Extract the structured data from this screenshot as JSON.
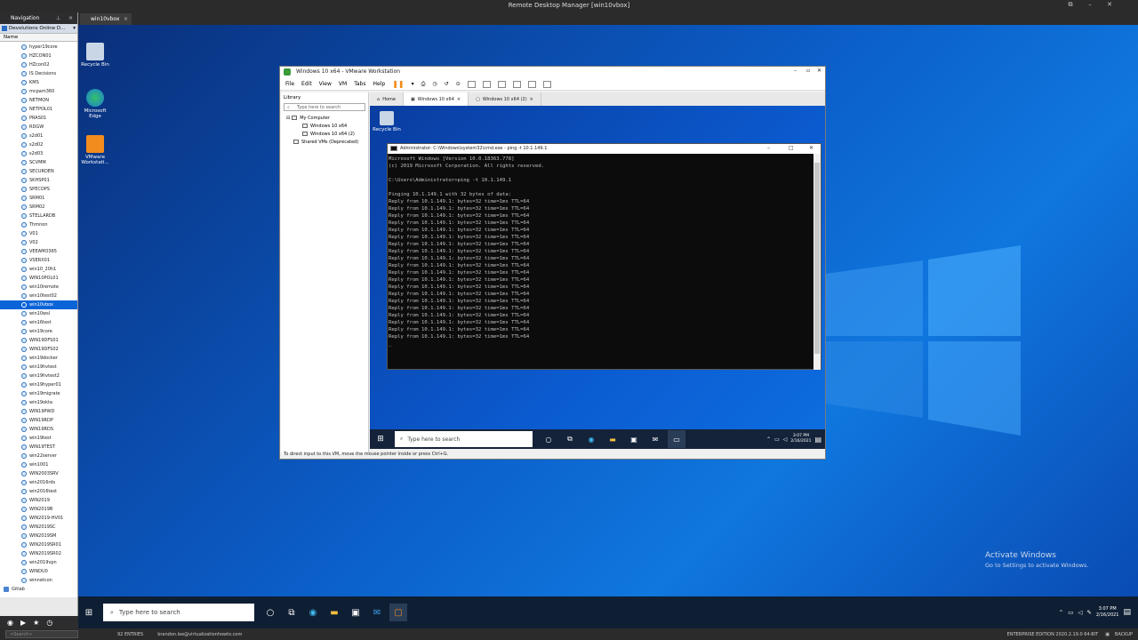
{
  "app": {
    "title": "Remote Desktop Manager [win10vbox]",
    "window_controls": [
      "⧉",
      "–",
      "✕"
    ]
  },
  "navigation": {
    "title": "Navigation",
    "datasource": "Devolutions Online D...",
    "column_header": "Name",
    "items": [
      "hyper19core",
      "HZCON01",
      "HZcon02",
      "IS Decisions",
      "KMS",
      "mcpam360",
      "NETMON",
      "NETPOL01",
      "PRAS01",
      "RDGW",
      "s2d01",
      "s2d02",
      "s2d03",
      "SCVMM",
      "SECURDEN",
      "SKHSP01",
      "SPECOPS",
      "SRM01",
      "SRM02",
      "STELLARDB",
      "Thmnon",
      "V01",
      "V02",
      "VEEAMO365",
      "VSERX01",
      "win10_20h1",
      "WIN10POL01",
      "win10remote",
      "win10test02",
      "win10vbox",
      "win10wsl",
      "win16test",
      "win19core",
      "WIN19DFS01",
      "WIN19DFS02",
      "win19docker",
      "win19hvtest",
      "win19hvtest2",
      "win19hyper01",
      "win19migrate",
      "win19okta",
      "WIN19PWD",
      "WIN19RDP",
      "WIN19RDS",
      "win19test",
      "WIN19TEST",
      "win22server",
      "win1001",
      "WIN2003SRV",
      "win2016rds",
      "win2016test",
      "WIN2019",
      "WIN2019B",
      "WIN2019-HV01",
      "WIN2019SC",
      "WIN2019SM",
      "WIN2019SR01",
      "WIN2019SR02",
      "win2019vpn",
      "WINDU0",
      "winnetcon"
    ],
    "selected": "win10vbox",
    "root_item": "Gitlab"
  },
  "tab": {
    "label": "win10vbox",
    "close": "×"
  },
  "desktop": {
    "icons": [
      "Recycle Bin",
      "Microsoft Edge",
      "VMware Workstati..."
    ],
    "activate_title": "Activate Windows",
    "activate_sub": "Go to Settings to activate Windows."
  },
  "taskbar": {
    "search_placeholder": "Type here to search",
    "time": "3:07 PM",
    "date": "2/16/2021"
  },
  "status": {
    "search_placeholder": "<Search>",
    "entries": "92 ENTRIES",
    "email": "brandon.lee@virtualizationhowto.com",
    "edition": "ENTERPRISE EDITION 2020.2.19.0 64-BIT",
    "backup": "BACKUP"
  },
  "vmware": {
    "title": "Windows 10 x64 - VMware Workstation",
    "menu": [
      "File",
      "Edit",
      "View",
      "VM",
      "Tabs",
      "Help"
    ],
    "library": {
      "title": "Library",
      "search_placeholder": "Type here to search",
      "tree": [
        "My Computer",
        "Windows 10 x64",
        "Windows 10 x64 (2)",
        "Shared VMs (Deprecated)"
      ]
    },
    "tabs": [
      "Home",
      "Windows 10 x64",
      "Windows 10 x64 (2)"
    ],
    "status": "To direct input to this VM, move the mouse pointer inside or press Ctrl+G."
  },
  "guest": {
    "recycle_bin": "Recycle Bin",
    "search_placeholder": "Type here to search",
    "time": "3:07 PM",
    "date": "2/16/2021"
  },
  "cmd": {
    "title": "Administrator: C:\\Windows\\system32\\cmd.exe - ping -t 10.1.149.1",
    "lines": [
      "Microsoft Windows [Version 10.0.18363.778]",
      "(c) 2019 Microsoft Corporation. All rights reserved.",
      "",
      "C:\\Users\\Administrator>ping -t 10.1.149.1",
      "",
      "Pinging 10.1.149.1 with 32 bytes of data:",
      "Reply from 10.1.149.1: bytes=32 time=1ms TTL=64",
      "Reply from 10.1.149.1: bytes=32 time=1ms TTL=64",
      "Reply from 10.1.149.1: bytes=32 time=1ms TTL=64",
      "Reply from 10.1.149.1: bytes=32 time=1ms TTL=64",
      "Reply from 10.1.149.1: bytes=32 time=1ms TTL=64",
      "Reply from 10.1.149.1: bytes=32 time=1ms TTL=64",
      "Reply from 10.1.149.1: bytes=32 time=1ms TTL=64",
      "Reply from 10.1.149.1: bytes=32 time=1ms TTL=64",
      "Reply from 10.1.149.1: bytes=32 time=1ms TTL=64",
      "Reply from 10.1.149.1: bytes=32 time=1ms TTL=64",
      "Reply from 10.1.149.1: bytes=32 time=1ms TTL=64",
      "Reply from 10.1.149.1: bytes=32 time=1ms TTL=64",
      "Reply from 10.1.149.1: bytes=32 time=1ms TTL=64",
      "Reply from 10.1.149.1: bytes=32 time=1ms TTL=64",
      "Reply from 10.1.149.1: bytes=32 time=1ms TTL=64",
      "Reply from 10.1.149.1: bytes=32 time=1ms TTL=64",
      "Reply from 10.1.149.1: bytes=32 time=1ms TTL=64",
      "Reply from 10.1.149.1: bytes=32 time=1ms TTL=64",
      "Reply from 10.1.149.1: bytes=32 time=1ms TTL=64",
      "Reply from 10.1.149.1: bytes=32 time=1ms TTL=64",
      "_"
    ]
  },
  "colors": {
    "accent": "#0a64d8",
    "desktop": "#0b5bc5",
    "console_text": "#c0c0c0"
  }
}
